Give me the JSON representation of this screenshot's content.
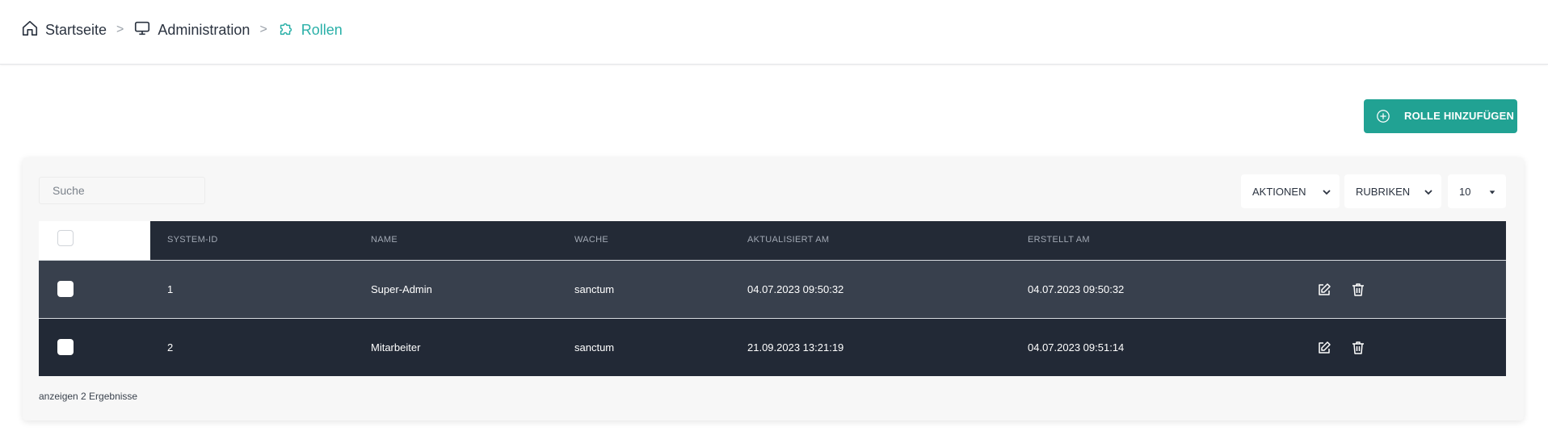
{
  "breadcrumb": {
    "home": "Startseite",
    "admin": "Administration",
    "current": "Rollen"
  },
  "actions": {
    "add_role": "ROLLE HINZUFÜGEN"
  },
  "toolbar": {
    "search_placeholder": "Suche",
    "actions_label": "AKTIONEN",
    "columns_label": "RUBRIKEN",
    "page_size": "10"
  },
  "table": {
    "headers": [
      "SYSTEM-ID",
      "NAME",
      "WACHE",
      "AKTUALISIERT AM",
      "ERSTELLT AM"
    ],
    "rows": [
      {
        "id": "1",
        "name": "Super-Admin",
        "guard": "sanctum",
        "updated": "04.07.2023 09:50:32",
        "created": "04.07.2023 09:50:32"
      },
      {
        "id": "2",
        "name": "Mitarbeiter",
        "guard": "sanctum",
        "updated": "21.09.2023 13:21:19",
        "created": "04.07.2023 09:51:14"
      }
    ]
  },
  "footer": {
    "results_text": "anzeigen 2 Ergebnisse"
  },
  "icons": {
    "home": "home-icon",
    "admin": "monitor-icon",
    "roles": "puzzle-icon",
    "add": "plus-circle-icon",
    "edit": "edit-icon",
    "delete": "trash-icon",
    "dropdown": "chevron-down-icon"
  },
  "colors": {
    "accent": "#21a293",
    "breadcrumb_active": "#2ab0a8",
    "table_header": "#232a36",
    "row_odd": "#38404d",
    "row_even": "#222936"
  }
}
